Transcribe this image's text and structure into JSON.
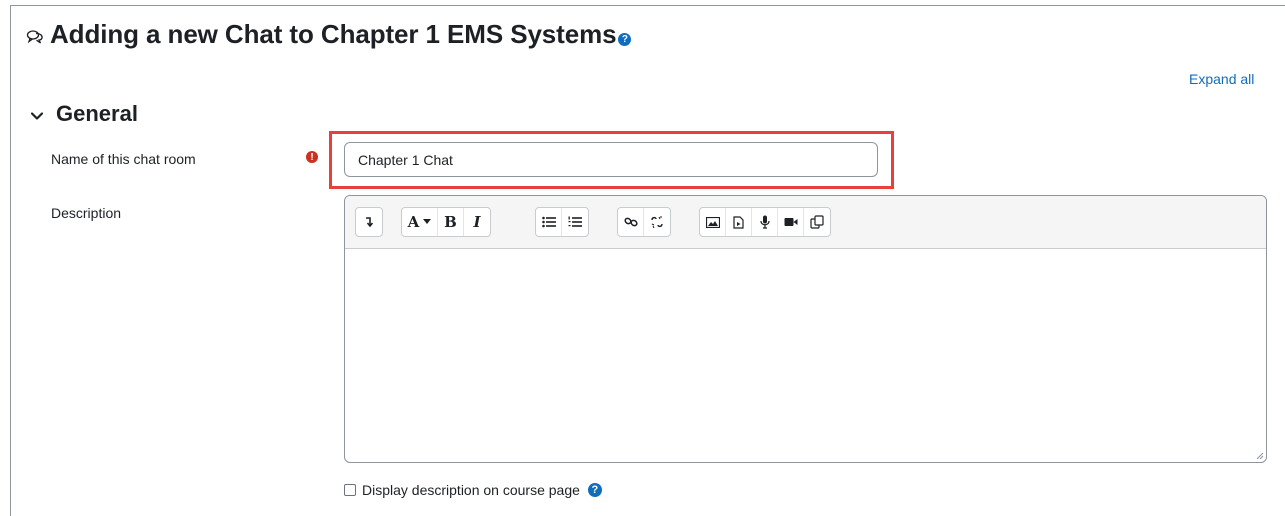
{
  "page": {
    "title": "Adding a new Chat to Chapter 1 EMS Systems",
    "help_icon": "question-circle-icon",
    "module_icon": "chat-bubbles-icon"
  },
  "expand_all_label": "Expand all",
  "section": {
    "title": "General",
    "toggle_icon": "chevron-down-icon"
  },
  "fields": {
    "name": {
      "label": "Name of this chat room",
      "value": "Chapter 1 Chat",
      "required_icon": "exclamation-circle-icon"
    },
    "description": {
      "label": "Description",
      "value": ""
    }
  },
  "toolbar": {
    "toggle_label": "↴",
    "font_label": "A",
    "bold_label": "B",
    "italic_label": "I",
    "icons": [
      "show-more-icon",
      "font-style-icon",
      "bold-icon",
      "italic-icon",
      "unordered-list-icon",
      "ordered-list-icon",
      "link-icon",
      "unlink-icon",
      "image-icon",
      "media-icon",
      "record-audio-icon",
      "record-video-icon",
      "manage-files-icon"
    ]
  },
  "display_description": {
    "label": "Display description on course page",
    "checked": false
  },
  "colors": {
    "accent": "#0f6cbf",
    "required": "#ca3120",
    "highlight": "#e8413c"
  }
}
